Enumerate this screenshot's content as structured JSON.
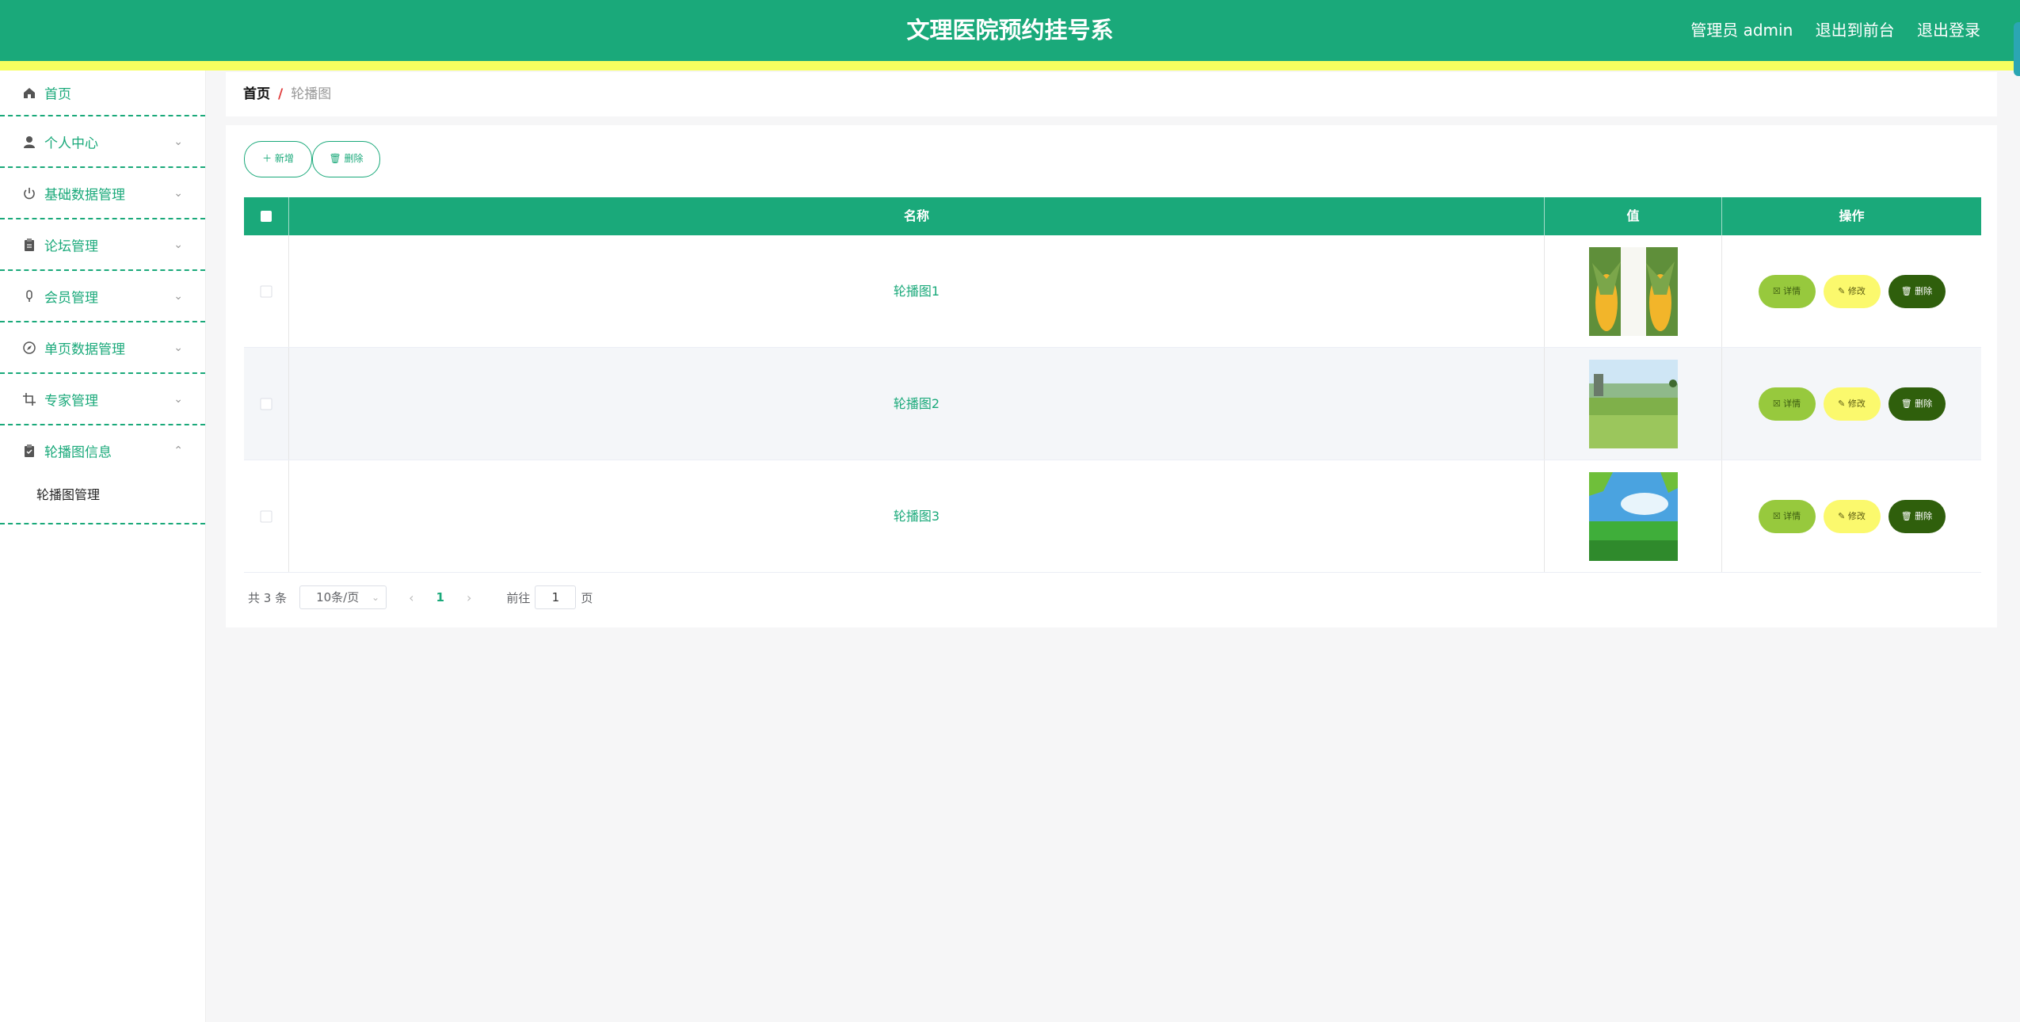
{
  "header": {
    "title": "文理医院预约挂号系",
    "user_label": "管理员 admin",
    "front_link": "退出到前台",
    "logout_link": "退出登录"
  },
  "sidebar": {
    "items": [
      {
        "label": "首页",
        "icon": "home-icon"
      },
      {
        "label": "个人中心",
        "icon": "user-icon"
      },
      {
        "label": "基础数据管理",
        "icon": "power-icon"
      },
      {
        "label": "论坛管理",
        "icon": "clipboard-icon"
      },
      {
        "label": "会员管理",
        "icon": "microphone-icon"
      },
      {
        "label": "单页数据管理",
        "icon": "compass-icon"
      },
      {
        "label": "专家管理",
        "icon": "crop-icon"
      },
      {
        "label": "轮播图信息",
        "icon": "checklist-icon"
      }
    ],
    "submenu": {
      "label": "轮播图管理"
    }
  },
  "breadcrumb": {
    "home": "首页",
    "separator": "/",
    "current": "轮播图"
  },
  "toolbar": {
    "add_label": "＋ 新增",
    "delete_label": "🗑 删除"
  },
  "table": {
    "headers": [
      "名称",
      "值",
      "操作"
    ],
    "rows": [
      {
        "name": "轮播图1",
        "image": "corn-image"
      },
      {
        "name": "轮播图2",
        "image": "grass-field-image"
      },
      {
        "name": "轮播图3",
        "image": "green-sky-image"
      }
    ],
    "actions": {
      "detail": "详情",
      "edit": "修改",
      "delete": "删除"
    }
  },
  "pagination": {
    "total_text": "共 3 条",
    "page_size": "10条/页",
    "current_page": "1",
    "goto_prefix": "前往",
    "goto_value": "1",
    "goto_suffix": "页"
  },
  "colors": {
    "primary": "#1aa97a",
    "accent_bar": "#f7ff5f",
    "detail_btn": "#97c93d",
    "edit_btn": "#fbf96d",
    "delete_btn": "#2f5f0c"
  }
}
